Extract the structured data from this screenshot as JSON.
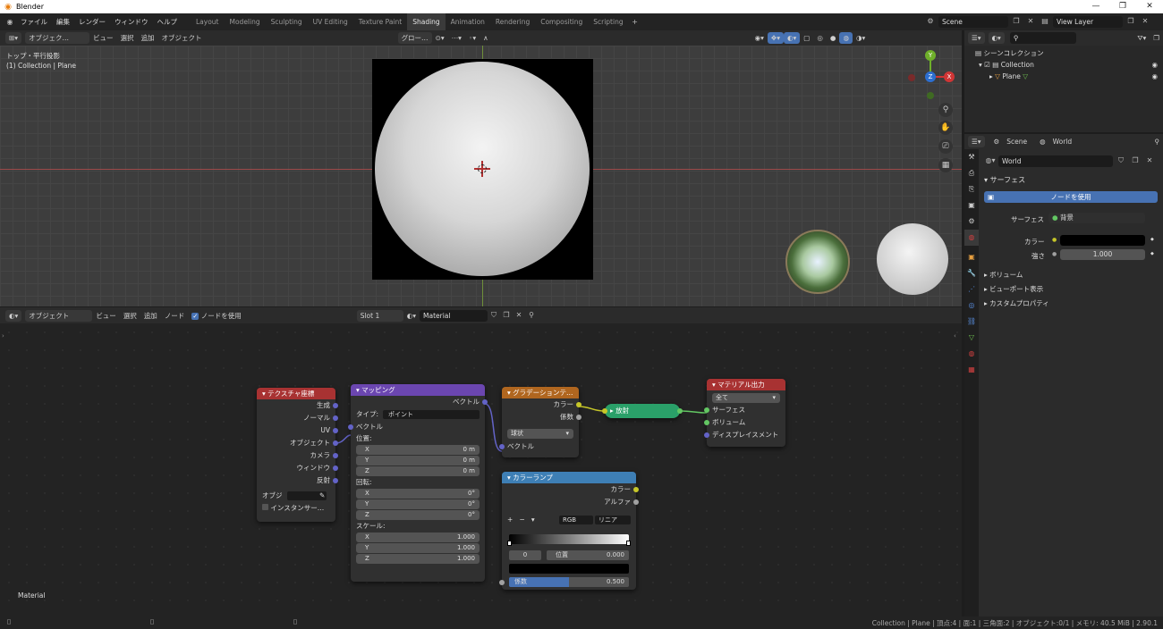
{
  "window": {
    "title": "Blender"
  },
  "menus": [
    "ファイル",
    "編集",
    "レンダー",
    "ウィンドウ",
    "ヘルプ"
  ],
  "workspaces": [
    "Layout",
    "Modeling",
    "Sculpting",
    "UV Editing",
    "Texture Paint",
    "Shading",
    "Animation",
    "Rendering",
    "Compositing",
    "Scripting"
  ],
  "active_workspace": "Shading",
  "scene_field": "Scene",
  "view_layer_field": "View Layer",
  "viewport": {
    "mode": "オブジェク…",
    "menus": [
      "ビュー",
      "選択",
      "追加",
      "オブジェクト"
    ],
    "orientation": "グロー…",
    "overlay_line1": "トップ・平行投影",
    "overlay_line2": "(1) Collection | Plane",
    "gizmo": {
      "y": "Y",
      "z": "Z",
      "x": "X"
    }
  },
  "node_editor": {
    "mode": "オブジェクト",
    "menus": [
      "ビュー",
      "選択",
      "追加",
      "ノード"
    ],
    "use_nodes_label": "ノードを使用",
    "slot": "Slot 1",
    "material": "Material",
    "bottom_label": "Material"
  },
  "nodes": {
    "texcoord": {
      "title": "テクスチャ座標",
      "outputs": [
        "生成",
        "ノーマル",
        "UV",
        "オブジェクト",
        "カメラ",
        "ウィンドウ",
        "反射"
      ],
      "object_label": "オブジ",
      "instancer_label": "インスタンサー…"
    },
    "mapping": {
      "title": "マッピング",
      "output": "ベクトル",
      "type_label": "タイプ:",
      "type_value": "ポイント",
      "input_vector": "ベクトル",
      "location_label": "位置:",
      "location": [
        {
          "axis": "X",
          "value": "0 m"
        },
        {
          "axis": "Y",
          "value": "0 m"
        },
        {
          "axis": "Z",
          "value": "0 m"
        }
      ],
      "rotation_label": "回転:",
      "rotation": [
        {
          "axis": "X",
          "value": "0°"
        },
        {
          "axis": "Y",
          "value": "0°"
        },
        {
          "axis": "Z",
          "value": "0°"
        }
      ],
      "scale_label": "スケール:",
      "scale": [
        {
          "axis": "X",
          "value": "1.000"
        },
        {
          "axis": "Y",
          "value": "1.000"
        },
        {
          "axis": "Z",
          "value": "1.000"
        }
      ]
    },
    "gradient": {
      "title": "グラデーションテ…",
      "out_color": "カラー",
      "out_fac": "係数",
      "type_value": "球状",
      "input_vector": "ベクトル"
    },
    "emission": {
      "title": "放射"
    },
    "output": {
      "title": "マテリアル出力",
      "target": "全て",
      "inputs": [
        "サーフェス",
        "ボリューム",
        "ディスプレイスメント"
      ]
    },
    "colorramp": {
      "title": "カラーランプ",
      "out_color": "カラー",
      "out_alpha": "アルファ",
      "plus": "+",
      "minus": "−",
      "mode": "RGB",
      "interp": "リニア",
      "index": "0",
      "pos_label": "位置",
      "pos_value": "0.000",
      "fac_label": "係数",
      "fac_value": "0.500",
      "fac_fill": 0.5
    }
  },
  "outliner": {
    "search_placeholder": "",
    "root": "シーンコレクション",
    "collection": "Collection",
    "object": "Plane"
  },
  "properties": {
    "scene": "Scene",
    "world": "World",
    "world_field": "World",
    "surface_panel": "サーフェス",
    "use_nodes_button": "ノードを使用",
    "surface_label": "サーフェス",
    "surface_value": "背景",
    "color_label": "カラー",
    "strength_label": "強さ",
    "strength_value": "1.000",
    "panels": [
      "ボリューム",
      "ビューポート表示",
      "カスタムプロパティ"
    ]
  },
  "statusbar": {
    "info": "Collection | Plane | 頂点:4 | 面:1 | 三角面:2 | オブジェクト:0/1 | メモリ: 40.5 MiB | 2.90.1"
  },
  "colors": {
    "texcoord": "#a83232",
    "mapping": "#6b46b0",
    "gradient": "#b0661f",
    "emission": "#2aa069",
    "output": "#a83232",
    "colorramp": "#3e7fb5",
    "accent": "#4772b3"
  }
}
